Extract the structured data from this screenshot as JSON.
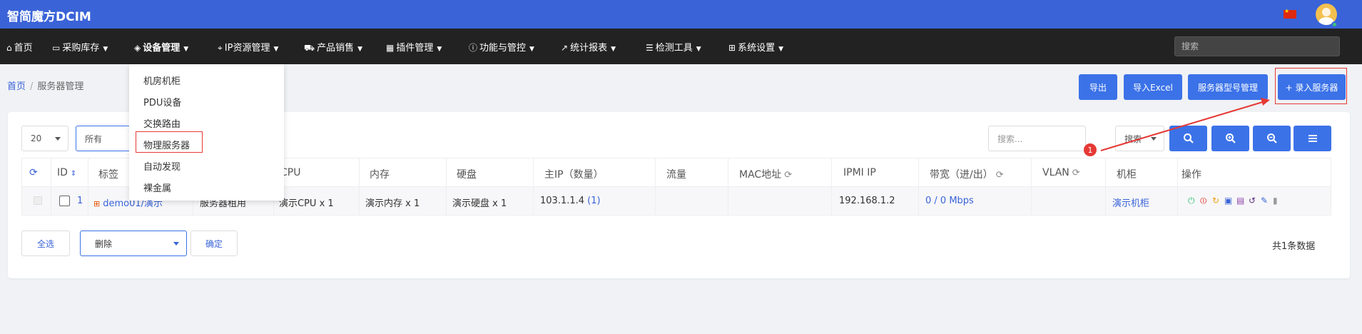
{
  "app": {
    "title": "智简魔方DCIM"
  },
  "nav": {
    "items": [
      {
        "label": "首页",
        "icon": "home-icon",
        "glyph": "⌂"
      },
      {
        "label": "采购库存",
        "icon": "box-icon",
        "glyph": "▭"
      },
      {
        "label": "设备管理",
        "icon": "cube-icon",
        "glyph": "◈"
      },
      {
        "label": "IP资源管理",
        "icon": "map-marker-icon",
        "glyph": "⌖"
      },
      {
        "label": "产品销售",
        "icon": "cart-icon",
        "glyph": "⛟"
      },
      {
        "label": "插件管理",
        "icon": "grid-icon",
        "glyph": "▦"
      },
      {
        "label": "功能与管控",
        "icon": "info-icon",
        "glyph": "ⓘ"
      },
      {
        "label": "统计报表",
        "icon": "chart-icon",
        "glyph": "↗"
      },
      {
        "label": "检测工具",
        "icon": "list-icon",
        "glyph": "☰"
      },
      {
        "label": "系统设置",
        "icon": "windows-icon",
        "glyph": "⊞"
      }
    ],
    "search_placeholder": "搜索"
  },
  "dropdown": {
    "items": [
      "机房机柜",
      "PDU设备",
      "交换路由",
      "物理服务器",
      "自动发现",
      "裸金属"
    ]
  },
  "breadcrumb": {
    "home": "首页",
    "current": "服务器管理"
  },
  "toolbar": {
    "export": "导出",
    "import_excel": "导入Excel",
    "model_manage": "服务器型号管理",
    "add_server": "+ 录入服务器"
  },
  "filters": {
    "page_size": "20",
    "status": "所有",
    "search_placeholder": "搜索...",
    "search_field": "搜索"
  },
  "table": {
    "columns": [
      "ID",
      "标签",
      "CPU",
      "内存",
      "硬盘",
      "主IP（数量）",
      "流量",
      "MAC地址",
      "IPMI IP",
      "带宽（进/出）",
      "VLAN",
      "机柜",
      "操作"
    ],
    "row": {
      "id": "1",
      "tag": "demo01/演示",
      "type": "服务器租用",
      "cpu": "演示CPU x 1",
      "memory": "演示内存 x 1",
      "disk": "演示硬盘 x 1",
      "ip": "103.1.1.4",
      "ip_count": "(1)",
      "traffic": "",
      "mac": "",
      "ipmi": "192.168.1.2",
      "bandwidth": "0 / 0 Mbps",
      "vlan": "",
      "cabinet": "演示机柜"
    }
  },
  "footer": {
    "select_all": "全选",
    "action": "删除",
    "confirm": "确定",
    "total": "共1条数据"
  },
  "annotation": {
    "step": "1"
  },
  "colors": {
    "topbar": "#3a63d8",
    "navbar": "#222222",
    "primary": "#3b72e8",
    "annotation": "#e53935"
  }
}
